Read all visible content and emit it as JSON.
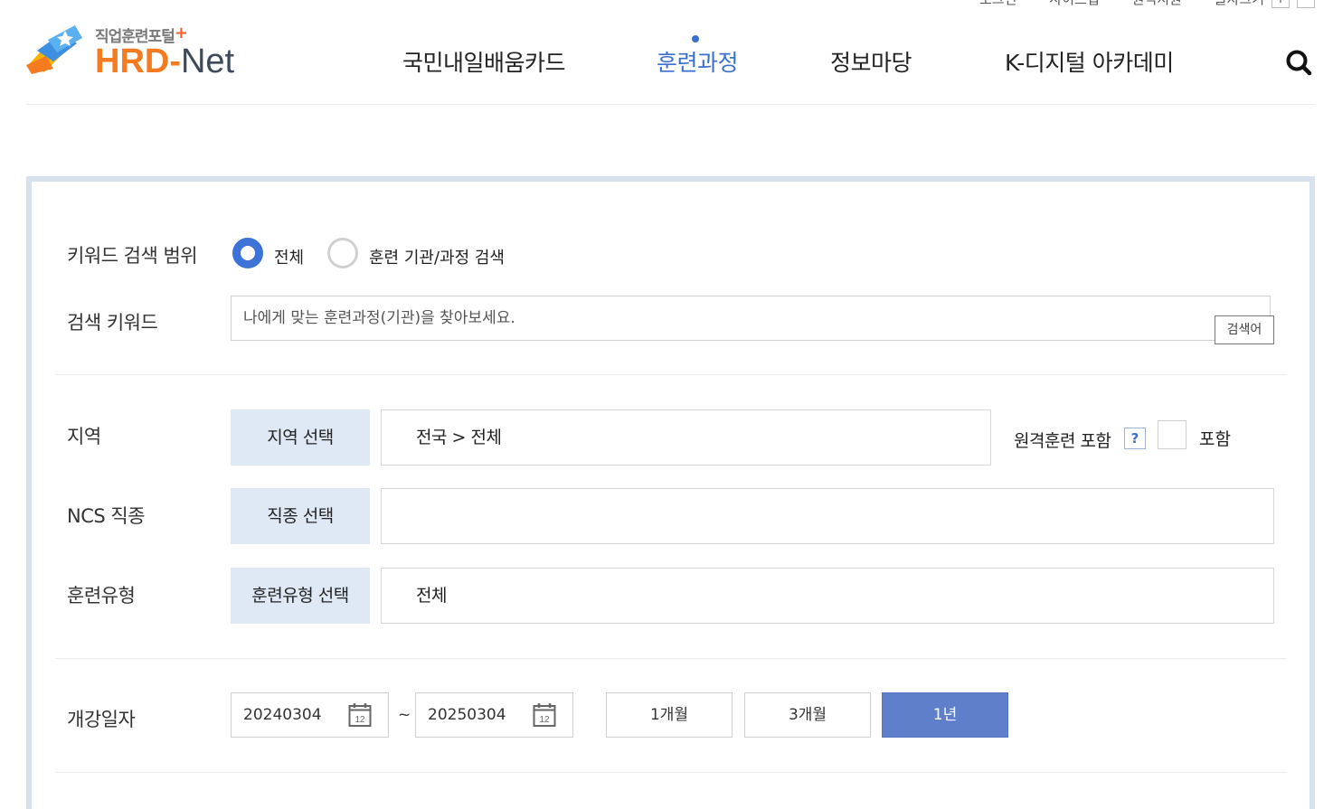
{
  "utility": {
    "login": "로그인",
    "sitemap": "사이트맵",
    "remote_support": "원격지원",
    "font_size": "글자크기",
    "zoom_in": "+",
    "zoom_out": "−"
  },
  "logo": {
    "subtitle": "직업훈련포털",
    "plus": "+",
    "hrd": "HRD",
    "dash": "-",
    "net": "Net"
  },
  "nav": {
    "items": [
      {
        "label": "국민내일배움카드"
      },
      {
        "label": "훈련과정",
        "active": true
      },
      {
        "label": "정보마당"
      },
      {
        "label": "K-디지털 아카데미"
      }
    ],
    "accent_color": "#3a6fd0"
  },
  "search": {
    "keyword_scope": {
      "label": "키워드 검색 범위",
      "options": [
        {
          "label": "전체",
          "selected": true
        },
        {
          "label": "훈련 기관/과정 검색",
          "selected": false
        }
      ]
    },
    "keyword": {
      "label": "검색 키워드",
      "placeholder": "나에게 맞는 훈련과정(기관)을 찾아보세요.",
      "value": "",
      "button_label": "검색어"
    },
    "region": {
      "label": "지역",
      "button_label": "지역 선택",
      "value": "전국 > 전체",
      "remote_label": "원격훈련 포함",
      "help_label": "?",
      "checkbox_label": "포함",
      "checked": false
    },
    "ncs": {
      "label": "NCS 직종",
      "button_label": "직종 선택",
      "value": ""
    },
    "training_type": {
      "label": "훈련유형",
      "button_label": "훈련유형 선택",
      "value": "전체"
    },
    "start_date": {
      "label": "개강일자",
      "from": "20240304",
      "separator": "~",
      "to": "20250304",
      "calendar_icon_text": "12",
      "periods": [
        {
          "label": "1개월",
          "active": false
        },
        {
          "label": "3개월",
          "active": false
        },
        {
          "label": "1년",
          "active": true
        }
      ],
      "active_color": "#5f7fcb"
    }
  }
}
